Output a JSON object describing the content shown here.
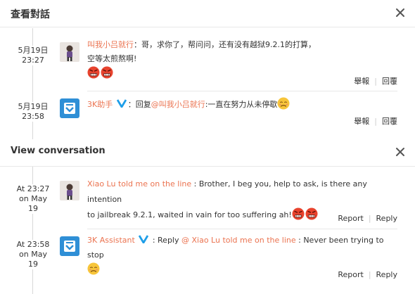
{
  "panel_zh": {
    "title": "查看對話",
    "items": [
      {
        "date": "5月19日",
        "time": "23:27",
        "username": "叫我小吕就行",
        "separator": "：",
        "text": "哥，求你了，帮问问，还有没有越狱9.2.1的打算，空等太煎熬啊!",
        "actions": [
          "舉報",
          "回覆"
        ]
      },
      {
        "date": "5月19日",
        "time": "23:58",
        "username": "3K助手",
        "separator": "：",
        "reply_prefix": "回复",
        "mention": "@叫我小吕就行",
        "text": ":一直在努力从未停歇",
        "actions": [
          "舉報",
          "回覆"
        ]
      }
    ]
  },
  "panel_en": {
    "title": "View conversation",
    "items": [
      {
        "timestamp_lines": [
          "At 23:27",
          "on May",
          "19"
        ],
        "username": "Xiao Lu told me on the line",
        "text_line1": " : Brother, I beg you, help to ask, is there any intention",
        "text_line2": "to jailbreak 9.2.1, waited in vain for too suffering ah!",
        "actions": [
          "Report",
          "Reply"
        ]
      },
      {
        "timestamp_lines": [
          "At 23:58",
          "on May",
          "19"
        ],
        "username": "3K Assistant",
        "separator": " : ",
        "reply_prefix": "Reply ",
        "mention": "@ Xiao Lu told me on the line",
        "text": " : Never been trying to stop",
        "actions": [
          "Report",
          "Reply"
        ]
      }
    ]
  },
  "colors": {
    "username": "#eb7350",
    "verified": "#1e9ee8",
    "angry_emoji": "#e8432e",
    "sad_emoji": "#f7c53a"
  },
  "icons": {
    "close": "close-icon",
    "verified": "verified-v-icon",
    "angry_face": "angry-face-emoji",
    "sad_face": "sad-face-emoji",
    "user_avatar": "user-avatar",
    "assistant_avatar": "3k-assistant-avatar"
  }
}
